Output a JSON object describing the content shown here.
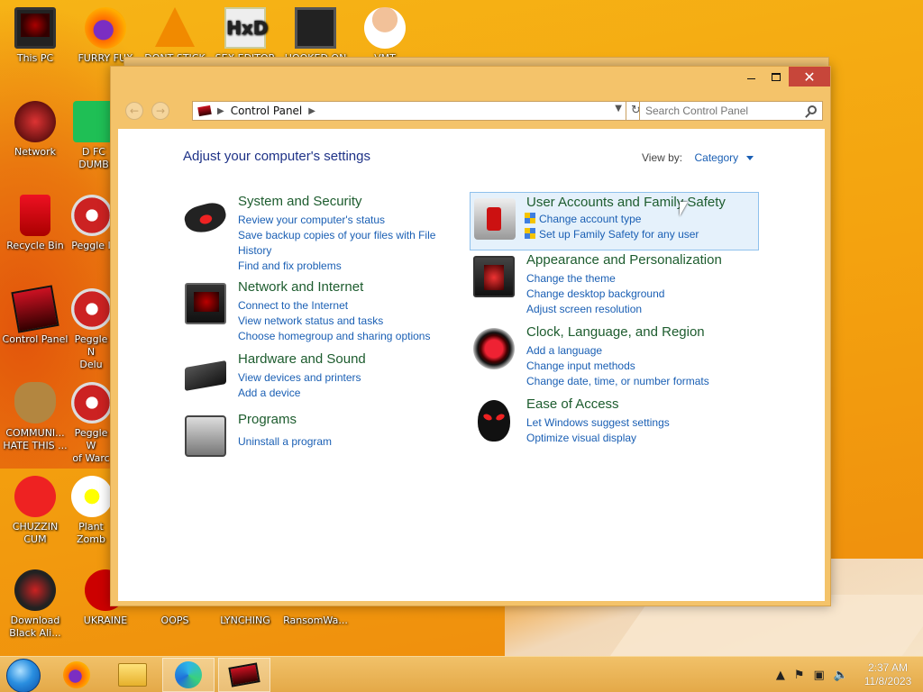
{
  "desktop": {
    "icons": [
      {
        "label": "This PC",
        "icon": "monitor-icon"
      },
      {
        "label": "FURRY FUX",
        "icon": "firefox-icon"
      },
      {
        "label": "DONT STICK",
        "icon": "vlc-icon"
      },
      {
        "label": "SEX EDITOR",
        "icon": "hex-editor-icon"
      },
      {
        "label": "HOOKED ON",
        "icon": "maze-icon"
      },
      {
        "label": "VMT",
        "icon": "doctor-icon"
      },
      {
        "label": "Network",
        "icon": "network-icon"
      },
      {
        "label": "D FC\nDUMB",
        "icon": "green-app-icon"
      },
      {
        "label": "Recycle Bin",
        "icon": "recycle-bin-icon"
      },
      {
        "label": "Peggle I",
        "icon": "peggle-icon"
      },
      {
        "label": "Control Panel",
        "icon": "control-panel-icon"
      },
      {
        "label": "Peggle N\nDelu",
        "icon": "peggle-icon"
      },
      {
        "label": "COMMUNI...\nHATE THIS ...",
        "icon": "money-bag-icon"
      },
      {
        "label": "Peggle W\nof Warc",
        "icon": "peggle-icon"
      },
      {
        "label": "CHUZZIN\nCUM",
        "icon": "chuzzle-icon"
      },
      {
        "label": "Plant\nZomb",
        "icon": "flower-icon"
      },
      {
        "label": "Download\nBlack Ali...",
        "icon": "black-ali-icon"
      },
      {
        "label": "UKRAINE",
        "icon": "radioactive-icon"
      },
      {
        "label": "OOPS",
        "icon": "app-icon"
      },
      {
        "label": "LYNCHING",
        "icon": "app-icon"
      },
      {
        "label": "RansomWa...",
        "icon": "app-icon"
      }
    ]
  },
  "window": {
    "address": {
      "crumb": "Control Panel"
    },
    "search": {
      "placeholder": "Search Control Panel"
    },
    "page_title": "Adjust your computer's settings",
    "view_by": {
      "label": "View by:",
      "value": "Category"
    },
    "categories": [
      {
        "title": "System and Security",
        "links": [
          "Review your computer's status",
          "Save backup copies of your files with File History",
          "Find and fix problems"
        ]
      },
      {
        "title": "Network and Internet",
        "links": [
          "Connect to the Internet",
          "View network status and tasks",
          "Choose homegroup and sharing options"
        ]
      },
      {
        "title": "Hardware and Sound",
        "links": [
          "View devices and printers",
          "Add a device"
        ]
      },
      {
        "title": "Programs",
        "links": [
          "Uninstall a program"
        ]
      },
      {
        "title": "User Accounts and Family Safety",
        "links": [
          "Change account type",
          "Set up Family Safety for any user"
        ]
      },
      {
        "title": "Appearance and Personalization",
        "links": [
          "Change the theme",
          "Change desktop background",
          "Adjust screen resolution"
        ]
      },
      {
        "title": "Clock, Language, and Region",
        "links": [
          "Add a language",
          "Change input methods",
          "Change date, time, or number formats"
        ]
      },
      {
        "title": "Ease of Access",
        "links": [
          "Let Windows suggest settings",
          "Optimize visual display"
        ]
      }
    ]
  },
  "taskbar": {
    "time": "2:37 AM",
    "date": "11/8/2023"
  },
  "colors": {
    "accent_link": "#1a5fb4",
    "category_title": "#1d5c2e",
    "window_frame": "#f4c36a",
    "close_button": "#c7463a"
  }
}
